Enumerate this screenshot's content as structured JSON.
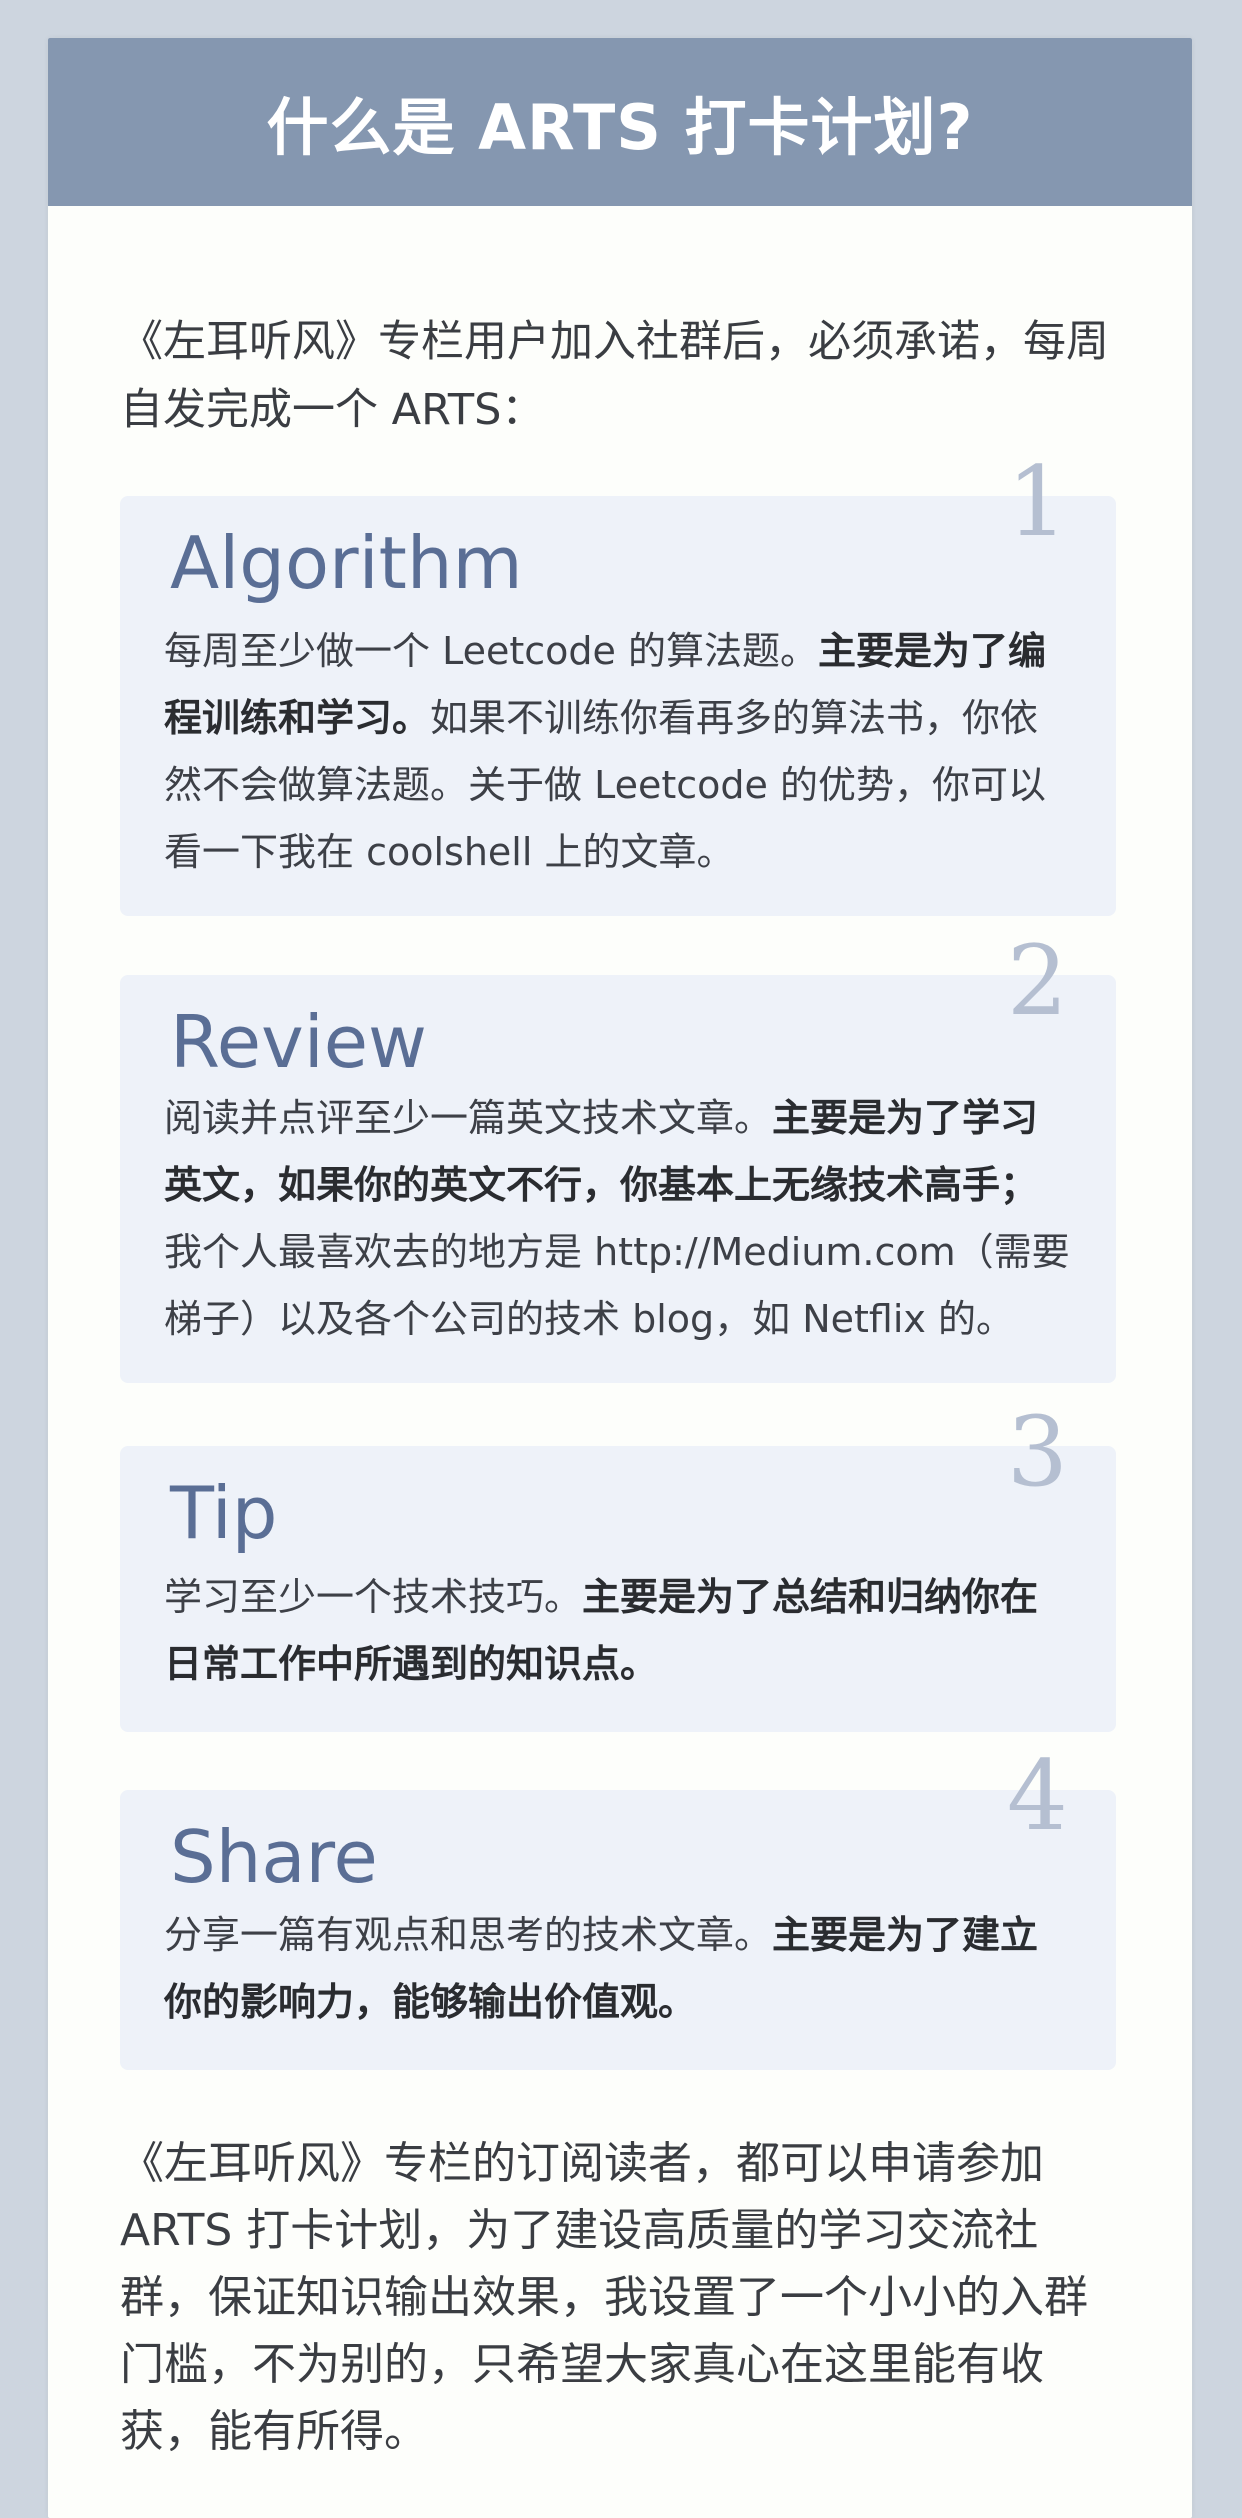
{
  "header": {
    "title": "什么是 ARTS 打卡计划?"
  },
  "intro": "《左耳听风》专栏用户加入社群后，必须承诺，每周自发完成一个 ARTS：",
  "sections": [
    {
      "number": "1",
      "title": "Algorithm",
      "text_before": "每周至少做一个 Leetcode 的算法题。",
      "text_bold": "主要是为了编程训练和学习。",
      "text_after": "如果不训练你看再多的算法书，你依然不会做算法题。关于做 Leetcode 的优势，你可以看一下我在 coolshell 上的文章。"
    },
    {
      "number": "2",
      "title": "Review",
      "text_before": "阅读并点评至少一篇英文技术文章。",
      "text_bold": "主要是为了学习英文，如果你的英文不行，你基本上无缘技术高手；",
      "text_after": "我个人最喜欢去的地方是 http://Medium.com（需要梯子）以及各个公司的技术 blog，如 Netflix 的。"
    },
    {
      "number": "3",
      "title": "Tip",
      "text_before": "学习至少一个技术技巧。",
      "text_bold": "主要是为了总结和归纳你在日常工作中所遇到的知识点。",
      "text_after": ""
    },
    {
      "number": "4",
      "title": "Share",
      "text_before": "分享一篇有观点和思考的技术文章。",
      "text_bold": "主要是为了建立你的影响力，能够输出价值观。",
      "text_after": ""
    }
  ],
  "outro": "《左耳听风》专栏的订阅读者，都可以申请参加 ARTS 打卡计划，为了建设高质量的学习交流社群，保证知识输出效果，我设置了一个小小的入群门槛，不为别的，只希望大家真心在这里能有收获，能有所得。",
  "colors": {
    "header_bg": "#8597b0",
    "box_bg": "#eef2f9",
    "title_color": "#5a6e95",
    "number_color": "#b5bfd1"
  }
}
